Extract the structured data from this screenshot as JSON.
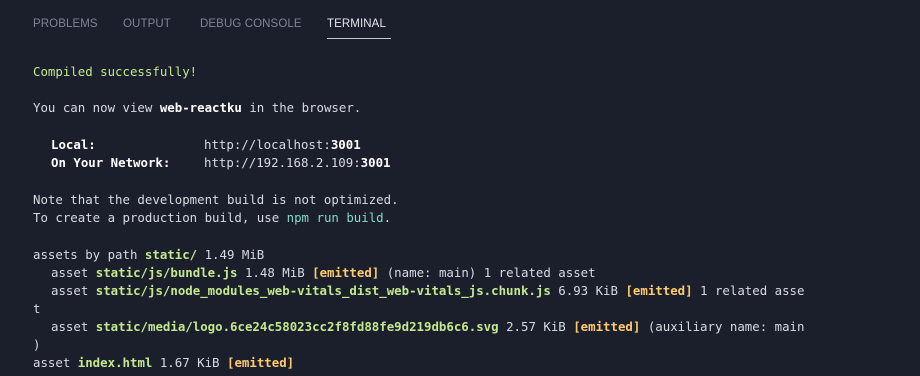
{
  "tabs": {
    "problems": "PROBLEMS",
    "output": "OUTPUT",
    "debug_console": "DEBUG CONSOLE",
    "terminal": "TERMINAL"
  },
  "terminal": {
    "compiled": "Compiled successfully!",
    "view_pre": "You can now view ",
    "app_name": "web-reactku",
    "view_post": " in the browser.",
    "local_label": "Local:",
    "local_url": "http://localhost:",
    "local_port": "3001",
    "network_label": "On Your Network:",
    "network_url": "http://192.168.2.109:",
    "network_port": "3001",
    "note1": "Note that the development build is not optimized.",
    "note2_pre": "To create a production build, use ",
    "note2_cmd": "npm run build",
    "note2_post": ".",
    "assets_pre": "assets by path ",
    "assets_path": "static/",
    "assets_size": " 1.49 MiB",
    "asset_word": "asset ",
    "emitted": "[emitted]",
    "a1_name": "static/js/bundle.js",
    "a1_size": " 1.48 MiB ",
    "a1_post": " (name: main) 1 related asset",
    "a2_name": "static/js/node_modules_web-vitals_dist_web-vitals_js.chunk.js",
    "a2_size": " 6.93 KiB ",
    "a2_post": " 1 related asse",
    "a2_wrap": "t",
    "a3_name": "static/media/logo.6ce24c58023cc2f8fd88fe9d219db6c6.svg",
    "a3_size": " 2.57 KiB ",
    "a3_post": " (auxiliary name: main",
    "a3_wrap": ")",
    "a4_name": "index.html",
    "a4_size": " 1.67 KiB "
  }
}
